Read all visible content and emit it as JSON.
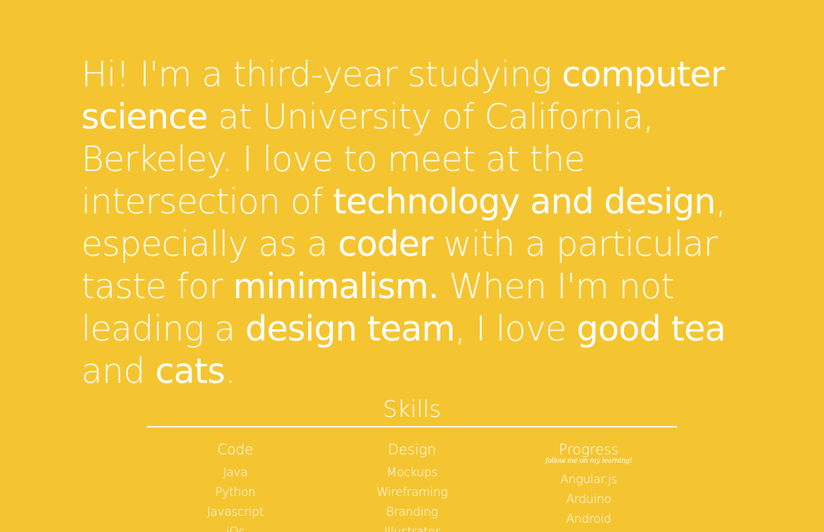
{
  "intro": {
    "t1": "Hi! I'm a third-year studying ",
    "h1": "computer science",
    "t2": " at University of California, Berkeley. I love to meet at the intersection of ",
    "h2": "technology and design",
    "t3": ", especially as a ",
    "h3": "coder",
    "t4": " with a particular taste for ",
    "h4": "minimalism.",
    "t5": " When I'm not leading a ",
    "h5": "design team",
    "t6": ", I love ",
    "h6": "good tea",
    "t7": " and ",
    "h7": "cats",
    "t8": "."
  },
  "skills": {
    "title": "Skills",
    "columns": [
      {
        "title": "Code",
        "subtitle": "",
        "items": [
          "Java",
          "Python",
          "Javascript",
          "iOs"
        ]
      },
      {
        "title": "Design",
        "subtitle": "",
        "items": [
          "Mockups",
          "Wireframing",
          "Branding",
          "Illustrator"
        ]
      },
      {
        "title": "Progress",
        "subtitle": "follow me on my learning!",
        "items": [
          "Angular.js",
          "Arduino",
          "Android"
        ]
      }
    ]
  },
  "colors": {
    "background": "#f4c531",
    "text": "#ffffff"
  }
}
